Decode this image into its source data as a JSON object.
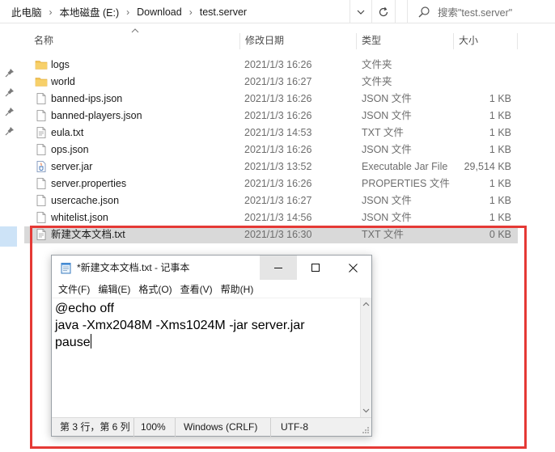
{
  "address_bar": {
    "breadcrumbs": [
      "此电脑",
      "本地磁盘 (E:)",
      "Download",
      "test.server"
    ],
    "separator_icon": "chevron-right-icon",
    "dropdown_icon": "chevron-down-icon",
    "refresh_icon": "refresh-icon",
    "search_placeholder": "搜索\"test.server\""
  },
  "columns": {
    "name": "名称",
    "date": "修改日期",
    "type": "类型",
    "size": "大小"
  },
  "files": [
    {
      "name": "logs",
      "date": "2021/1/3 16:26",
      "type": "文件夹",
      "size": "",
      "icon": "folder-icon"
    },
    {
      "name": "world",
      "date": "2021/1/3 16:27",
      "type": "文件夹",
      "size": "",
      "icon": "folder-icon"
    },
    {
      "name": "banned-ips.json",
      "date": "2021/1/3 16:26",
      "type": "JSON 文件",
      "size": "1 KB",
      "icon": "file-icon"
    },
    {
      "name": "banned-players.json",
      "date": "2021/1/3 16:26",
      "type": "JSON 文件",
      "size": "1 KB",
      "icon": "file-icon"
    },
    {
      "name": "eula.txt",
      "date": "2021/1/3 14:53",
      "type": "TXT 文件",
      "size": "1 KB",
      "icon": "text-file-icon"
    },
    {
      "name": "ops.json",
      "date": "2021/1/3 16:26",
      "type": "JSON 文件",
      "size": "1 KB",
      "icon": "file-icon"
    },
    {
      "name": "server.jar",
      "date": "2021/1/3 13:52",
      "type": "Executable Jar File",
      "size": "29,514 KB",
      "icon": "jar-file-icon"
    },
    {
      "name": "server.properties",
      "date": "2021/1/3 16:26",
      "type": "PROPERTIES 文件",
      "size": "1 KB",
      "icon": "file-icon"
    },
    {
      "name": "usercache.json",
      "date": "2021/1/3 16:27",
      "type": "JSON 文件",
      "size": "1 KB",
      "icon": "file-icon"
    },
    {
      "name": "whitelist.json",
      "date": "2021/1/3 14:56",
      "type": "JSON 文件",
      "size": "1 KB",
      "icon": "file-icon"
    },
    {
      "name": "新建文本文档.txt",
      "date": "2021/1/3 16:30",
      "type": "TXT 文件",
      "size": "0 KB",
      "icon": "text-file-icon",
      "selected": true
    }
  ],
  "notepad": {
    "title": "*新建文本文档.txt - 记事本",
    "menu": [
      "文件(F)",
      "编辑(E)",
      "格式(O)",
      "查看(V)",
      "帮助(H)"
    ],
    "lines": [
      "@echo off",
      "java -Xmx2048M -Xms1024M -jar server.jar",
      "pause"
    ],
    "status": {
      "position": "第 3 行，第 6 列",
      "zoom": "100%",
      "line_ending": "Windows (CRLF)",
      "encoding": "UTF-8"
    }
  },
  "colors": {
    "highlight_frame": "#e53935",
    "selected_row": "#d9d9d9",
    "folder": "#f2c14e"
  }
}
